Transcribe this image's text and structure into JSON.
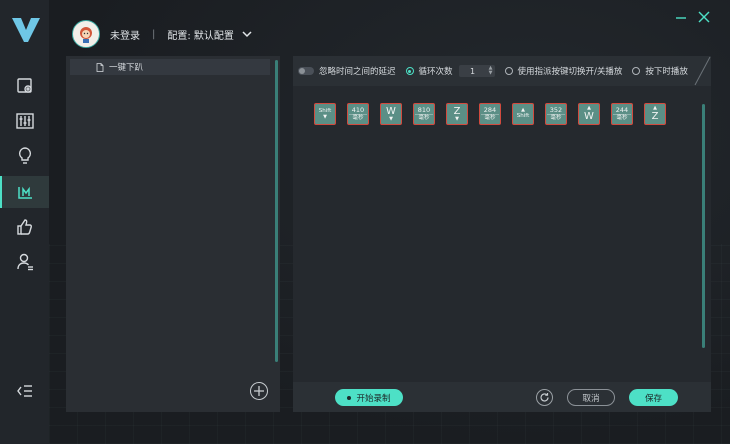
{
  "header": {
    "user_label": "未登录",
    "separator": "|",
    "config_label": "配置: 默认配置"
  },
  "sidebar": {
    "items": [
      {
        "icon": "display-settings-icon"
      },
      {
        "icon": "equalizer-icon"
      },
      {
        "icon": "lightbulb-icon"
      },
      {
        "icon": "macro-icon",
        "active": true
      },
      {
        "icon": "thumbs-up-icon"
      },
      {
        "icon": "user-profile-icon"
      }
    ],
    "collapse_icon": "collapse-menu-icon"
  },
  "macro_list": {
    "items": [
      {
        "label": "一键下趴"
      }
    ]
  },
  "options": {
    "ignore_delay_label": "忽略时间之间的延迟",
    "loop_count_label": "循环次数",
    "loop_count_value": "1",
    "toggle_mode_label": "使用指派按键切换开/关播放",
    "hold_mode_label": "按下时播放"
  },
  "macro_steps": [
    {
      "type": "key",
      "label": "Shift",
      "direction": "down"
    },
    {
      "type": "delay",
      "value": "410",
      "unit": "毫秒"
    },
    {
      "type": "key",
      "label": "W",
      "direction": "down"
    },
    {
      "type": "delay",
      "value": "810",
      "unit": "毫秒"
    },
    {
      "type": "key",
      "label": "Z",
      "direction": "down"
    },
    {
      "type": "delay",
      "value": "284",
      "unit": "毫秒"
    },
    {
      "type": "key",
      "label": "Shift",
      "direction": "up"
    },
    {
      "type": "delay",
      "value": "352",
      "unit": "毫秒"
    },
    {
      "type": "key",
      "label": "W",
      "direction": "up"
    },
    {
      "type": "delay",
      "value": "244",
      "unit": "毫秒"
    },
    {
      "type": "key",
      "label": "Z",
      "direction": "up"
    }
  ],
  "footer": {
    "record_label": "开始录制",
    "cancel_label": "取消",
    "save_label": "保存"
  },
  "colors": {
    "accent": "#4de0c6",
    "key_fill": "#5b8f86",
    "key_border": "#d24a3e"
  }
}
